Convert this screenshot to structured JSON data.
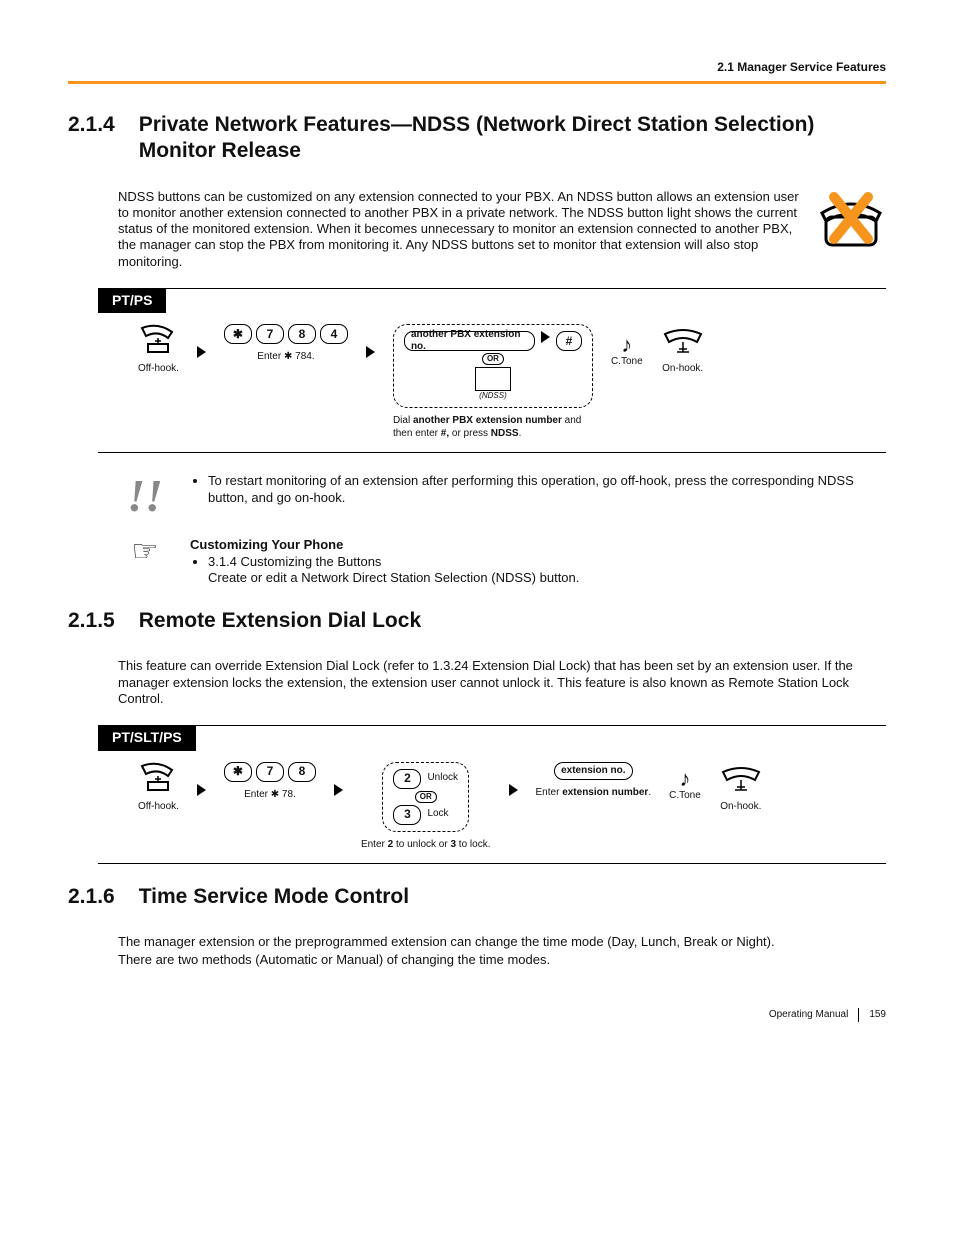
{
  "header": {
    "section_ref": "2.1 Manager Service Features"
  },
  "s214": {
    "num": "2.1.4",
    "title": "Private Network Features—NDSS (Network Direct Station Selection) Monitor Release",
    "intro": "NDSS buttons can be customized on any extension connected to your PBX. An NDSS button allows an extension user to monitor another extension connected to another PBX in a private network. The NDSS button light shows the current status of the monitored extension. When it becomes unnecessary to monitor an extension connected to another PBX, the manager can stop the PBX from monitoring it. Any NDSS buttons set to monitor that extension will also stop monitoring.",
    "diag_label": "PT/PS",
    "offhook": "Off-hook.",
    "enter784_a": "Enter ",
    "enter784_b": " 784.",
    "opt_label": "another PBX extension no.",
    "hash": "#",
    "or": "OR",
    "ndss_caption": "(NDSS)",
    "dial_cap_a": "Dial ",
    "dial_cap_b": "another PBX extension number",
    "dial_cap_c": " and then enter ",
    "dial_cap_d": "#,",
    "dial_cap_e": " or press ",
    "dial_cap_f": "NDSS",
    "dial_cap_g": ".",
    "ctone": "C.Tone",
    "onhook": "On-hook.",
    "note": "To restart monitoring of an extension after performing this operation, go off-hook, press the corresponding NDSS button, and go on-hook.",
    "custom_title": "Customizing Your Phone",
    "custom_line1": "3.1.4 Customizing the Buttons",
    "custom_line2": "Create or edit a Network Direct Station Selection (NDSS) button."
  },
  "s215": {
    "num": "2.1.5",
    "title": "Remote Extension Dial Lock",
    "intro": "This feature can override Extension Dial Lock (refer to 1.3.24 Extension Dial Lock) that has been set by an extension user. If the manager extension locks the extension, the extension user cannot unlock it. This feature is also known as Remote Station Lock Control.",
    "diag_label": "PT/SLT/PS",
    "offhook": "Off-hook.",
    "enter78_a": "Enter ",
    "enter78_b": " 78.",
    "k2": "2",
    "k3": "3",
    "unlock": "Unlock",
    "lock": "Lock",
    "or": "OR",
    "opt_cap_a": "Enter ",
    "opt_cap_b": "2",
    "opt_cap_c": " to unlock or ",
    "opt_cap_d": "3",
    "opt_cap_e": " to lock.",
    "extno": "extension no.",
    "ext_cap_a": "Enter ",
    "ext_cap_b": "extension number",
    "ext_cap_c": ".",
    "ctone": "C.Tone",
    "onhook": "On-hook."
  },
  "s216": {
    "num": "2.1.6",
    "title": "Time Service Mode Control",
    "p1": "The manager extension or the preprogrammed extension can change the time mode (Day, Lunch, Break or Night).",
    "p2": "There are two methods (Automatic or Manual) of changing the time modes."
  },
  "footer": {
    "manual": "Operating Manual",
    "page": "159"
  }
}
